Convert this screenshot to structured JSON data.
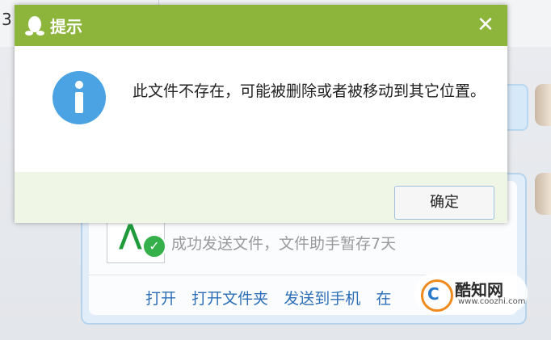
{
  "background": {
    "topbar_fragment": "3",
    "file_card": {
      "status_text": "成功发送文件，文件助手暂存7天",
      "actions": [
        "打开",
        "打开文件夹",
        "发送到手机",
        "在"
      ]
    }
  },
  "dialog": {
    "title": "提示",
    "close_symbol": "✕",
    "message": "此文件不存在，可能被删除或者被移动到其它位置。",
    "ok_label": "确定",
    "colors": {
      "titlebar": "#8db43b",
      "footer": "#f0f6e6",
      "info_icon": "#4ba3e3"
    }
  },
  "watermark": {
    "name": "酷知网",
    "url": "www.coozhi.com"
  }
}
